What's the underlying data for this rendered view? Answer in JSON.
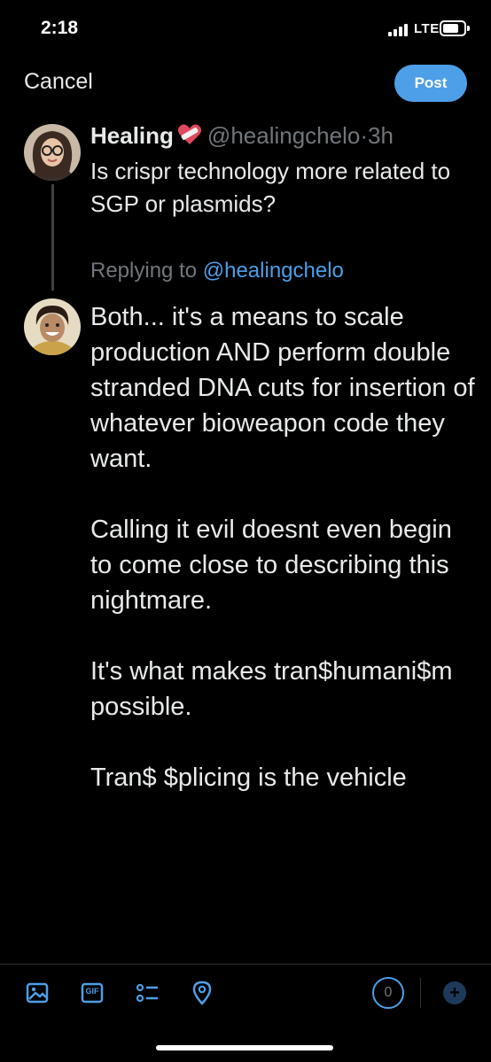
{
  "status_bar": {
    "time": "2:18",
    "network": "LTE"
  },
  "header": {
    "cancel_label": "Cancel",
    "post_label": "Post"
  },
  "original_tweet": {
    "author_name": "Healing",
    "handle": "@healingchelo",
    "separator": "·",
    "time_ago": "3h",
    "text": "Is crispr technology more related to SGP or plasmids?",
    "avatar_icon": "woman-with-glasses-avatar",
    "emoji_icon": "bandaged-heart-icon"
  },
  "reply": {
    "replying_prefix": "Replying to",
    "replying_handle": "@healingchelo",
    "avatar_icon": "man-smiling-avatar",
    "paragraphs": [
      "Both... it's a means to scale production AND perform double stranded DNA cuts for insertion of whatever bioweapon code they want.",
      "Calling it evil doesnt even begin to come close to describing this nightmare.",
      "It's what makes tran$humani$m possible.",
      "Tran$ $plicing is the vehicle"
    ]
  },
  "toolbar": {
    "icons": [
      "image-icon",
      "gif-icon",
      "poll-icon",
      "location-icon"
    ],
    "gif_label": "GIF",
    "char_counter": "0",
    "add_label": "+"
  },
  "colors": {
    "accent": "#4d9fe8",
    "background": "#000000",
    "muted": "#71767b",
    "text": "#e7e9ea"
  }
}
